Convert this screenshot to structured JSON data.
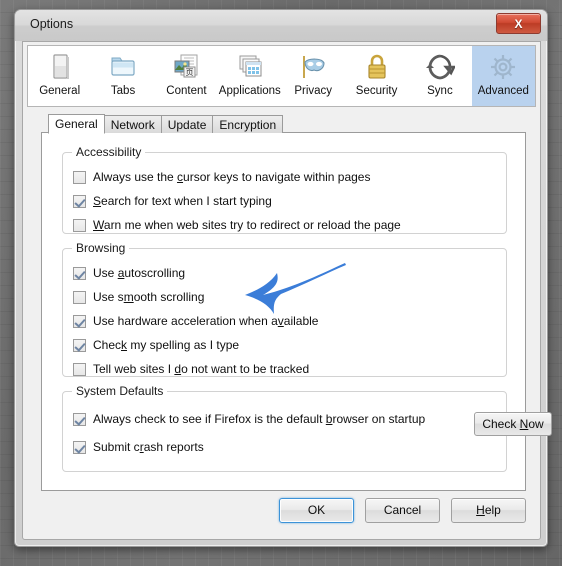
{
  "window": {
    "title": "Options",
    "close_label": "X"
  },
  "toolbar": {
    "items": [
      {
        "label": "General",
        "icon": "document-page-icon",
        "selected": false
      },
      {
        "label": "Tabs",
        "icon": "folder-tabs-icon",
        "selected": false
      },
      {
        "label": "Content",
        "icon": "content-page-icon",
        "selected": false
      },
      {
        "label": "Applications",
        "icon": "applications-icon",
        "selected": false
      },
      {
        "label": "Privacy",
        "icon": "privacy-mask-icon",
        "selected": false
      },
      {
        "label": "Security",
        "icon": "security-padlock-icon",
        "selected": false
      },
      {
        "label": "Sync",
        "icon": "sync-arrows-icon",
        "selected": false
      },
      {
        "label": "Advanced",
        "icon": "advanced-gear-icon",
        "selected": true
      }
    ]
  },
  "subtabs": [
    {
      "label": "General",
      "active": true
    },
    {
      "label": "Network",
      "active": false
    },
    {
      "label": "Update",
      "active": false
    },
    {
      "label": "Encryption",
      "active": false
    }
  ],
  "groups": {
    "accessibility": {
      "title": "Accessibility",
      "options": [
        {
          "checked": false,
          "pre": "Always use the ",
          "accel": "c",
          "post": "ursor keys to navigate within pages"
        },
        {
          "checked": true,
          "pre": "",
          "accel": "S",
          "post": "earch for text when I start typing"
        },
        {
          "checked": false,
          "pre": "",
          "accel": "W",
          "post": "arn me when web sites try to redirect or reload the page"
        }
      ]
    },
    "browsing": {
      "title": "Browsing",
      "options": [
        {
          "checked": true,
          "pre": "Use ",
          "accel": "a",
          "post": "utoscrolling"
        },
        {
          "checked": false,
          "pre": "Use s",
          "accel": "m",
          "post": "ooth scrolling"
        },
        {
          "checked": true,
          "pre": "Use hardware acceleration when a",
          "accel": "v",
          "post": "ailable"
        },
        {
          "checked": true,
          "pre": "Chec",
          "accel": "k",
          "post": " my spelling as I type"
        },
        {
          "checked": false,
          "pre": "Tell web sites I ",
          "accel": "d",
          "post": "o not want to be tracked"
        }
      ]
    },
    "system_defaults": {
      "title": "System Defaults",
      "options": [
        {
          "checked": true,
          "pre": "Always check to see if Firefox is the default ",
          "accel": "b",
          "post": "rowser on startup"
        },
        {
          "checked": true,
          "pre": "Submit c",
          "accel": "r",
          "post": "ash reports"
        }
      ],
      "check_now": {
        "pre": "Check ",
        "accel": "N",
        "post": "ow"
      }
    }
  },
  "footer": {
    "ok": {
      "pre": "OK",
      "accel": "",
      "post": ""
    },
    "cancel": {
      "pre": "Cancel",
      "accel": "",
      "post": ""
    },
    "help": {
      "pre": "",
      "accel": "H",
      "post": "elp"
    }
  },
  "annotation": {
    "type": "arrow",
    "color": "#3b7dd8",
    "points_at": "Use hardware acceleration when available"
  },
  "colors": {
    "selected_tab_bg": "#b9d2ee",
    "arrow_blue": "#3b7dd8",
    "close_red": "#cf4a31",
    "panel_bg": "#ffffff",
    "dialog_bg": "#f0f0f0"
  }
}
